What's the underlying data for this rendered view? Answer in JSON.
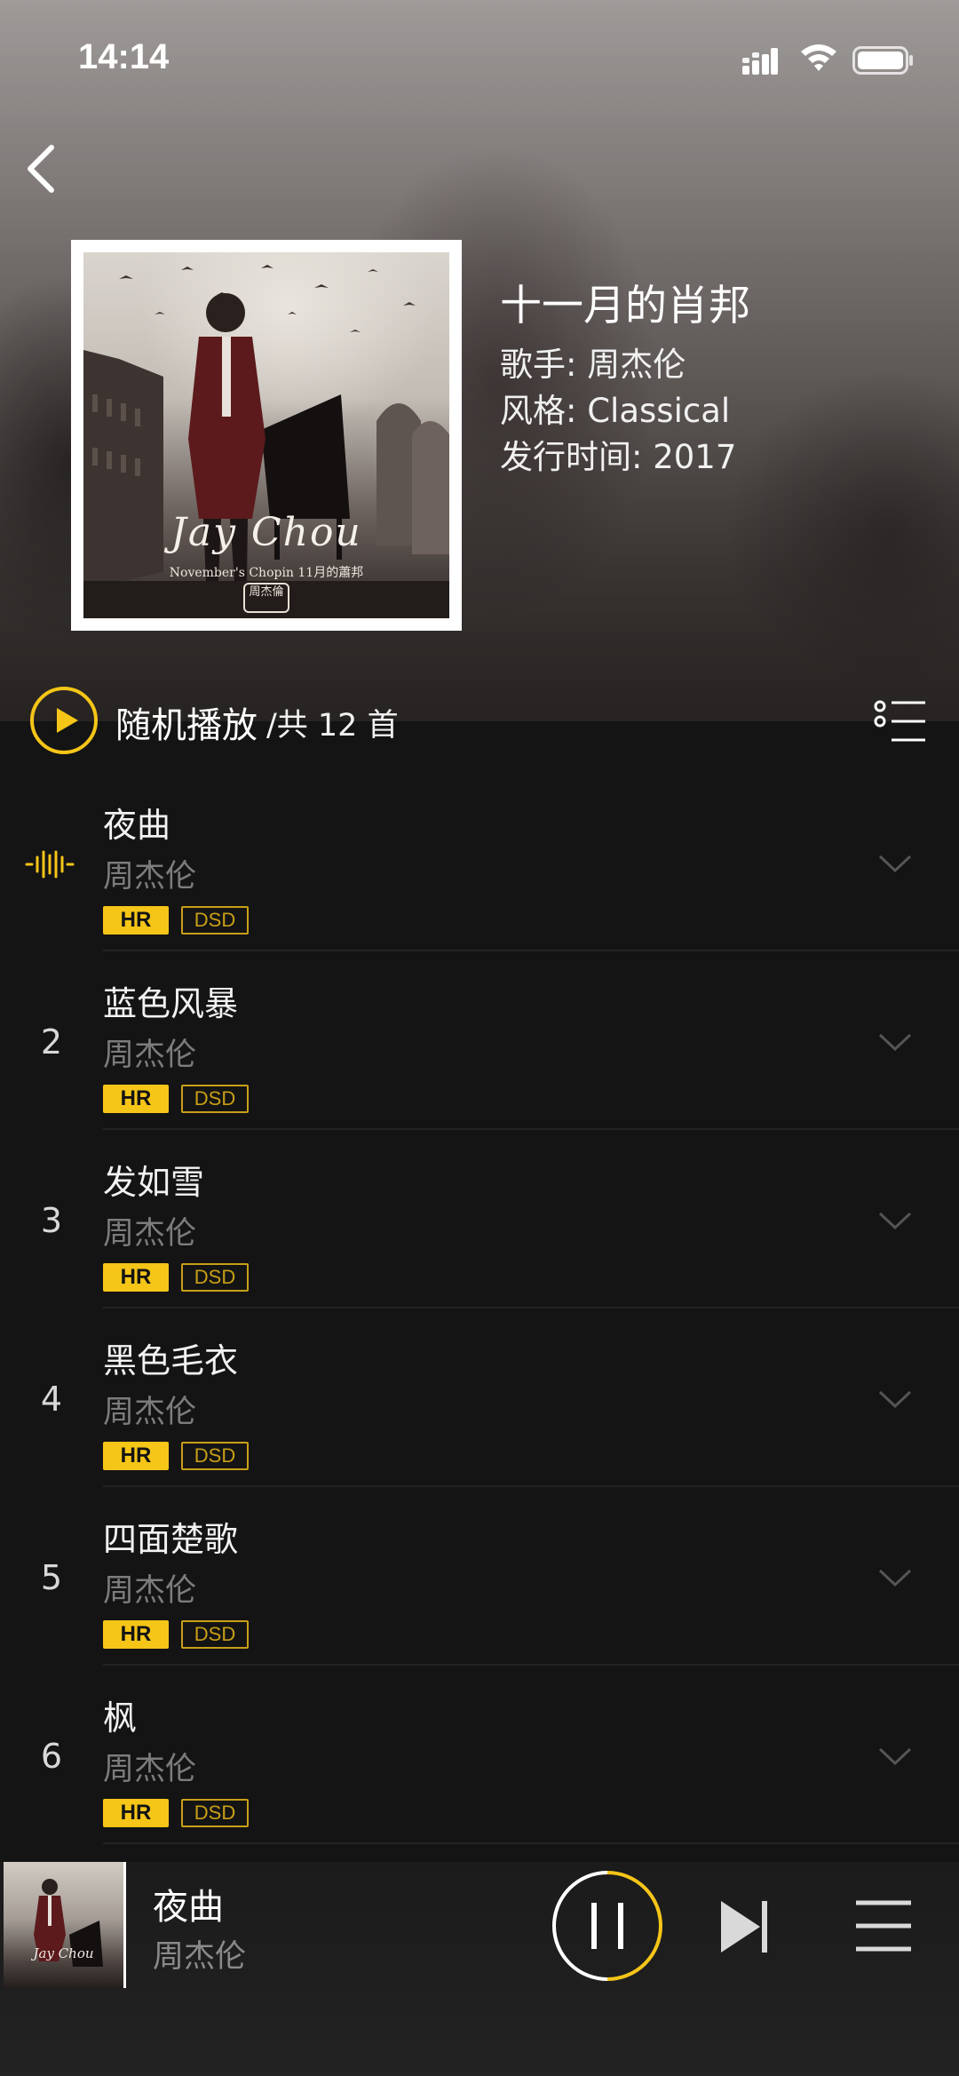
{
  "status_bar": {
    "time": "14:14",
    "icons": [
      "signal-icon",
      "wifi-icon",
      "battery-icon"
    ]
  },
  "album": {
    "title": "十一月的肖邦",
    "artist_line": "歌手: 周杰伦",
    "genre_line": "风格: Classical",
    "release_line": "发行时间: 2017",
    "cover_art_text": {
      "title": "Jay Chou",
      "subtitle": "November's Chopin 11月的蕭邦",
      "seal": "周杰倫"
    }
  },
  "play_all": {
    "label": "随机播放",
    "count": "/共 12 首"
  },
  "colors": {
    "accent": "#f5c518",
    "background": "#141414",
    "muted_text": "#7c7c7c"
  },
  "tracks": [
    {
      "number": "",
      "playing": true,
      "title": "夜曲",
      "artist": "周杰伦",
      "badges": [
        "HR",
        "DSD"
      ]
    },
    {
      "number": "2",
      "playing": false,
      "title": "蓝色风暴",
      "artist": "周杰伦",
      "badges": [
        "HR",
        "DSD"
      ]
    },
    {
      "number": "3",
      "playing": false,
      "title": "发如雪",
      "artist": "周杰伦",
      "badges": [
        "HR",
        "DSD"
      ]
    },
    {
      "number": "4",
      "playing": false,
      "title": "黑色毛衣",
      "artist": "周杰伦",
      "badges": [
        "HR",
        "DSD"
      ]
    },
    {
      "number": "5",
      "playing": false,
      "title": "四面楚歌",
      "artist": "周杰伦",
      "badges": [
        "HR",
        "DSD"
      ]
    },
    {
      "number": "6",
      "playing": false,
      "title": "枫",
      "artist": "周杰伦",
      "badges": [
        "HR",
        "DSD"
      ]
    }
  ],
  "now_playing": {
    "title": "夜曲",
    "artist": "周杰伦",
    "cover_text": "Jay Chou",
    "state": "playing"
  }
}
